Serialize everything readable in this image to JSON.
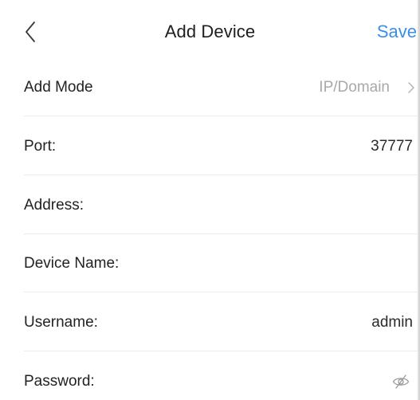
{
  "header": {
    "back_icon": "chevron-left-icon",
    "title": "Add Device",
    "save_label": "Save"
  },
  "form": {
    "add_mode": {
      "label": "Add Mode",
      "value": "IP/Domain",
      "chevron_icon": "chevron-right-icon"
    },
    "port": {
      "label": "Port:",
      "value": "37777"
    },
    "address": {
      "label": "Address:",
      "value": ""
    },
    "device_name": {
      "label": "Device Name:",
      "value": ""
    },
    "username": {
      "label": "Username:",
      "value": "admin"
    },
    "password": {
      "label": "Password:",
      "value": "",
      "toggle_icon": "eye-off-icon"
    }
  },
  "colors": {
    "accent": "#3a8fe6",
    "muted_text": "#a9a9a9",
    "divider": "#ececec"
  }
}
